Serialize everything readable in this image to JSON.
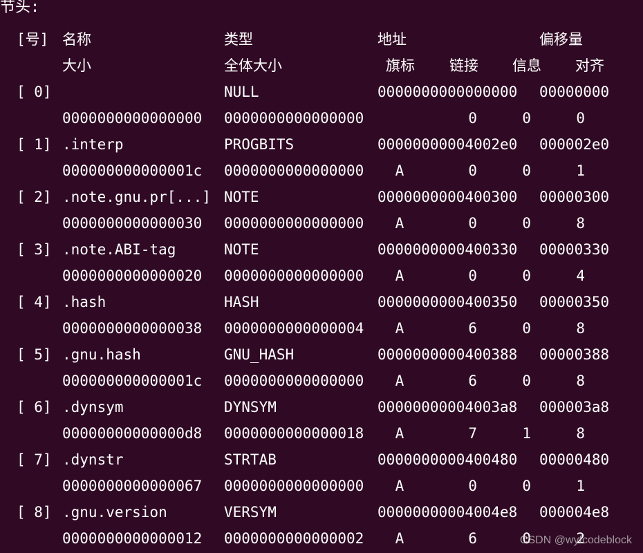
{
  "window": {
    "background": "#300a24",
    "text_color": "#ffffff"
  },
  "title": "节头:",
  "header": {
    "row1": {
      "num": "[号]",
      "name": "名称",
      "type": "类型",
      "addr": "地址",
      "offset": "偏移量"
    },
    "row2": {
      "size": "大小",
      "entsize": "全体大小",
      "flags": "旗标",
      "link": "链接",
      "info": "信息",
      "align": "对齐"
    }
  },
  "sections": [
    {
      "num": "[ 0]",
      "name": "",
      "type": "NULL",
      "addr": "0000000000000000",
      "offset": "00000000",
      "size": "0000000000000000",
      "entsize": "0000000000000000",
      "flags": "",
      "link": "0",
      "info": "0",
      "align": "0"
    },
    {
      "num": "[ 1]",
      "name": ".interp",
      "type": "PROGBITS",
      "addr": "00000000004002e0",
      "offset": "000002e0",
      "size": "000000000000001c",
      "entsize": "0000000000000000",
      "flags": "A",
      "link": "0",
      "info": "0",
      "align": "1"
    },
    {
      "num": "[ 2]",
      "name": ".note.gnu.pr[...]",
      "type": "NOTE",
      "addr": "0000000000400300",
      "offset": "00000300",
      "size": "0000000000000030",
      "entsize": "0000000000000000",
      "flags": "A",
      "link": "0",
      "info": "0",
      "align": "8"
    },
    {
      "num": "[ 3]",
      "name": ".note.ABI-tag",
      "type": "NOTE",
      "addr": "0000000000400330",
      "offset": "00000330",
      "size": "0000000000000020",
      "entsize": "0000000000000000",
      "flags": "A",
      "link": "0",
      "info": "0",
      "align": "4"
    },
    {
      "num": "[ 4]",
      "name": ".hash",
      "type": "HASH",
      "addr": "0000000000400350",
      "offset": "00000350",
      "size": "0000000000000038",
      "entsize": "0000000000000004",
      "flags": "A",
      "link": "6",
      "info": "0",
      "align": "8"
    },
    {
      "num": "[ 5]",
      "name": ".gnu.hash",
      "type": "GNU_HASH",
      "addr": "0000000000400388",
      "offset": "00000388",
      "size": "000000000000001c",
      "entsize": "0000000000000000",
      "flags": "A",
      "link": "6",
      "info": "0",
      "align": "8"
    },
    {
      "num": "[ 6]",
      "name": ".dynsym",
      "type": "DYNSYM",
      "addr": "00000000004003a8",
      "offset": "000003a8",
      "size": "00000000000000d8",
      "entsize": "0000000000000018",
      "flags": "A",
      "link": "7",
      "info": "1",
      "align": "8"
    },
    {
      "num": "[ 7]",
      "name": ".dynstr",
      "type": "STRTAB",
      "addr": "0000000000400480",
      "offset": "00000480",
      "size": "0000000000000067",
      "entsize": "0000000000000000",
      "flags": "A",
      "link": "0",
      "info": "0",
      "align": "1"
    },
    {
      "num": "[ 8]",
      "name": ".gnu.version",
      "type": "VERSYM",
      "addr": "00000000004004e8",
      "offset": "000004e8",
      "size": "0000000000000012",
      "entsize": "0000000000000002",
      "flags": "A",
      "link": "6",
      "info": "0",
      "align": "2"
    }
  ],
  "watermark": "CSDN @wyfcodeblock"
}
